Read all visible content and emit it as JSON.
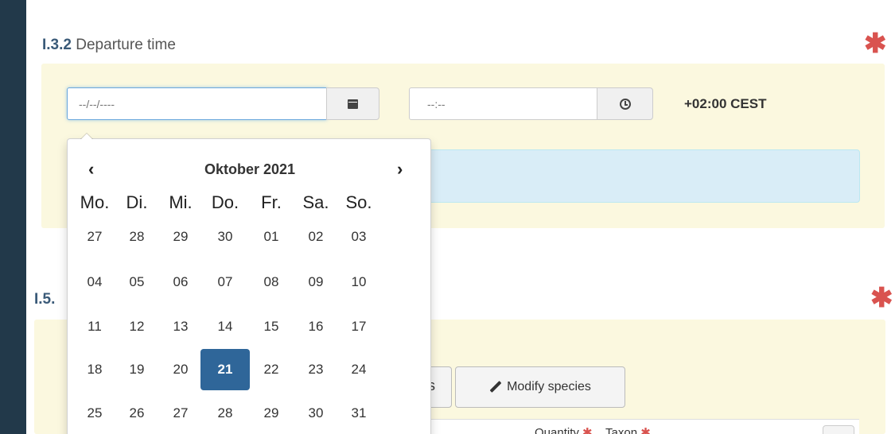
{
  "section_i32": {
    "number": "I.3.2",
    "title": "Departure time",
    "required_mark": "✱",
    "date_input": {
      "value": "",
      "placeholder": "--/--/----"
    },
    "date_button_icon": "calendar-icon",
    "time_input": {
      "value": "",
      "placeholder": "--:--"
    },
    "time_button_icon": "clock-icon",
    "timezone": "+02:00 CEST"
  },
  "section_i5": {
    "number": "I.5.",
    "required_mark": "✱",
    "hidden_button_partial": "s",
    "modify_species_button": "Modify species",
    "modify_species_icon": "pencil-icon",
    "table_header_quantity": "Quantity",
    "table_header_taxon": "Taxon",
    "table_header_required": "✱"
  },
  "datepicker": {
    "prev": "‹",
    "next": "›",
    "month_label": "Oktober 2021",
    "weekdays": [
      "Mo.",
      "Di.",
      "Mi.",
      "Do.",
      "Fr.",
      "Sa.",
      "So."
    ],
    "weeks": [
      [
        "27",
        "28",
        "29",
        "30",
        "01",
        "02",
        "03"
      ],
      [
        "04",
        "05",
        "06",
        "07",
        "08",
        "09",
        "10"
      ],
      [
        "11",
        "12",
        "13",
        "14",
        "15",
        "16",
        "17"
      ],
      [
        "18",
        "19",
        "20",
        "21",
        "22",
        "23",
        "24"
      ],
      [
        "25",
        "26",
        "27",
        "28",
        "29",
        "30",
        "31"
      ]
    ],
    "selected_day": "21"
  },
  "colors": {
    "sidebar": "#22394a",
    "accent_blue": "#2f6699",
    "required_red": "#d9534f",
    "panel_yellow": "#fbf8df",
    "info_blue": "#d9edf7"
  }
}
